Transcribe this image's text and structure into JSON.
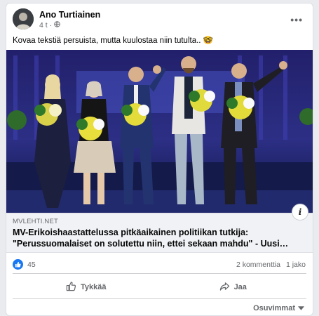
{
  "post": {
    "author": "Ano Turtiainen",
    "time": "4 t",
    "privacy_icon": "public-globe-icon",
    "text": "Kovaa tekstiä persuista, mutta kuulostaa niin tutulta.. 🤓"
  },
  "link": {
    "domain": "MVLEHTI.NET",
    "headline": "MV-Erikoishaastattelussa pitkäaikainen politiikan tutkija: \"Perussuomalaiset on solutettu niin, ettei sekaan mahdu\" - Uusi…",
    "info_icon": "i"
  },
  "stats": {
    "likes": "45",
    "comments": "2 kommenttia",
    "shares": "1 jako"
  },
  "actions": {
    "like": "Tykkää",
    "share": "Jaa"
  },
  "comments_sort": "Osuvimmat",
  "colors": {
    "accent": "#1877f2",
    "stage_blue": "#2b2c7a"
  }
}
